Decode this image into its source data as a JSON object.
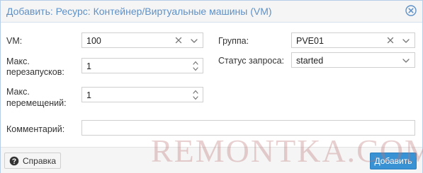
{
  "dialog": {
    "title": "Добавить: Ресурс: Контейнер/Виртуальные машины (VM)"
  },
  "form": {
    "vm": {
      "label": "VM:",
      "value": "100"
    },
    "max_restarts": {
      "label": "Макс. перезапусков:",
      "label_line1": "Макс.",
      "label_line2": "перезапусков:",
      "value": "1"
    },
    "max_relocations": {
      "label": "Макс. перемещений:",
      "label_line1": "Макс.",
      "label_line2": "перемещений:",
      "value": "1"
    },
    "group": {
      "label": "Группа:",
      "value": "PVE01"
    },
    "request_state": {
      "label": "Статус запроса:",
      "value": "started"
    },
    "comment": {
      "label": "Комментарий:",
      "value": ""
    }
  },
  "footer": {
    "help_label": "Справка",
    "add_label": "Добавить"
  },
  "watermark": "REMONTKA.COM",
  "colors": {
    "title": "#5f91c6",
    "primary_button": "#3892d4"
  },
  "icons": {
    "close": "close-circle-icon",
    "clear": "clear-x-icon",
    "dropdown": "chevron-down-icon",
    "spinner": "spinner-updown-icon",
    "help": "question-circle-icon"
  }
}
